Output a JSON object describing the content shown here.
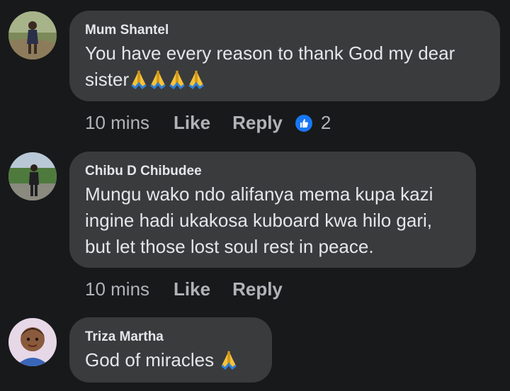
{
  "comments": [
    {
      "author": "Mum Shantel",
      "text": "You have every reason to thank God my dear sister",
      "emoji_count": 4,
      "emoji": "folded-hands-icon",
      "time": "10 mins",
      "like_label": "Like",
      "reply_label": "Reply",
      "reaction_icon": "thumbs-up-icon",
      "reaction_count": "2"
    },
    {
      "author": "Chibu D Chibudee",
      "text": "Mungu wako ndo alifanya mema kupa kazi ingine hadi ukakosa kuboard kwa hilo gari, but let those lost soul rest in peace.",
      "time": "10 mins",
      "like_label": "Like",
      "reply_label": "Reply"
    },
    {
      "author": "Triza Martha",
      "text": "God of miracles",
      "emoji_count": 1,
      "emoji": "folded-hands-icon"
    }
  ],
  "colors": {
    "background": "#18191a",
    "bubble": "#3a3b3c",
    "text": "#e4e6eb",
    "secondary_text": "#b0b3b8",
    "like_blue": "#1877f2"
  }
}
